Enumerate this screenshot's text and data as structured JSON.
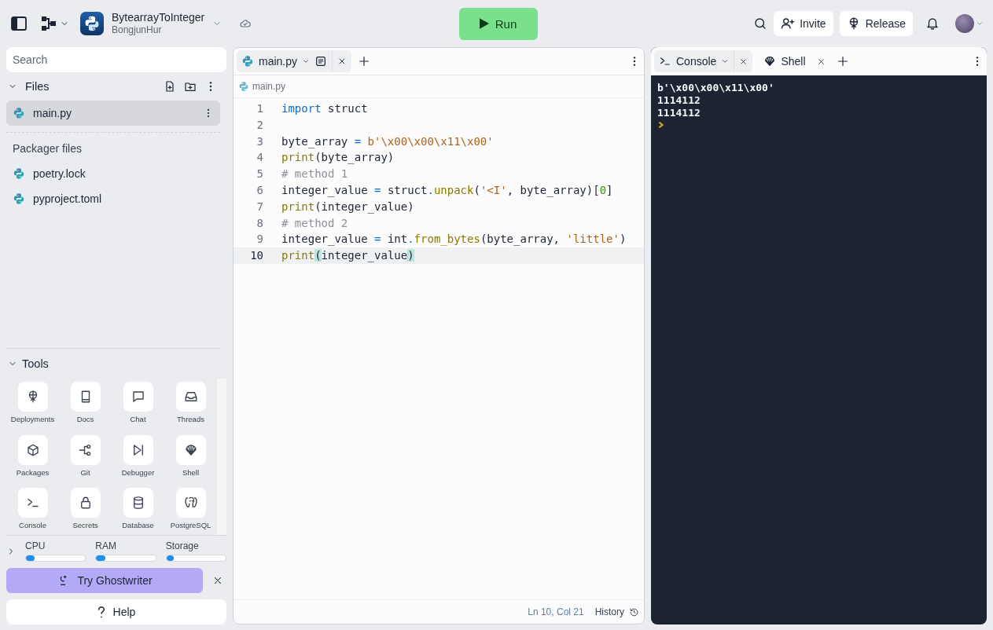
{
  "topbar": {
    "repl_name": "BytearrayToInteger",
    "owner": "BongjunHur",
    "run_label": "Run",
    "invite_label": "Invite",
    "release_label": "Release"
  },
  "sidebar": {
    "search": {
      "placeholder": "Search"
    },
    "files_title": "Files",
    "files": [
      {
        "name": "main.py",
        "selected": true
      }
    ],
    "packager_title": "Packager files",
    "packager_files": [
      {
        "name": "poetry.lock",
        "selected": false
      },
      {
        "name": "pyproject.toml",
        "selected": false
      }
    ],
    "tools_title": "Tools",
    "tools": [
      {
        "label": "Deployments",
        "kind": "deploy"
      },
      {
        "label": "Docs",
        "kind": "docs"
      },
      {
        "label": "Chat",
        "kind": "chat"
      },
      {
        "label": "Threads",
        "kind": "threads"
      },
      {
        "label": "Packages",
        "kind": "packages"
      },
      {
        "label": "Git",
        "kind": "git"
      },
      {
        "label": "Debugger",
        "kind": "debugger"
      },
      {
        "label": "Shell",
        "kind": "shell"
      },
      {
        "label": "Console",
        "kind": "console"
      },
      {
        "label": "Secrets",
        "kind": "secrets"
      },
      {
        "label": "Database",
        "kind": "database"
      },
      {
        "label": "PostgreSQL",
        "kind": "postgres"
      }
    ],
    "meters": [
      {
        "label": "CPU",
        "level": 0.15
      },
      {
        "label": "RAM",
        "level": 0.15
      },
      {
        "label": "Storage",
        "level": 0.13
      }
    ],
    "ghostwriter_label": "Try Ghostwriter",
    "help_label": "Help"
  },
  "editor": {
    "tab": {
      "label": "main.py",
      "selected": true
    },
    "breadcrumb": "main.py",
    "lines": [
      {
        "number": "1",
        "active": false,
        "tokens": [
          {
            "kind": "kw",
            "text": "import"
          },
          {
            "kind": "plain",
            "text": " struct"
          }
        ]
      },
      {
        "number": "2",
        "active": false
      },
      {
        "number": "3",
        "active": false,
        "tokens": [
          {
            "kind": "plain",
            "text": "byte_array "
          },
          {
            "kind": "op",
            "text": "= "
          },
          {
            "kind": "str",
            "text": "b'\\x00\\x00\\x11\\x00'"
          }
        ]
      },
      {
        "number": "4",
        "active": false,
        "tokens": [
          {
            "kind": "fn",
            "text": "print"
          },
          {
            "kind": "plain",
            "text": "(byte_array)"
          }
        ]
      },
      {
        "number": "5",
        "active": false,
        "tokens": [
          {
            "kind": "cm",
            "text": "# method 1"
          }
        ]
      },
      {
        "number": "6",
        "active": false,
        "tokens": [
          {
            "kind": "plain",
            "text": "integer_value "
          },
          {
            "kind": "op",
            "text": "="
          },
          {
            "kind": "plain",
            "text": " struct"
          },
          {
            "kind": "op",
            "text": "."
          },
          {
            "kind": "fn",
            "text": "unpack"
          },
          {
            "kind": "plain",
            "text": "("
          },
          {
            "kind": "str",
            "text": "'<I'"
          },
          {
            "kind": "plain",
            "text": ", byte_array)["
          },
          {
            "kind": "num",
            "text": "0"
          },
          {
            "kind": "plain",
            "text": "]"
          }
        ]
      },
      {
        "number": "7",
        "active": false,
        "tokens": [
          {
            "kind": "fn",
            "text": "print"
          },
          {
            "kind": "plain",
            "text": "(integer_value)"
          }
        ]
      },
      {
        "number": "8",
        "active": false,
        "tokens": [
          {
            "kind": "cm",
            "text": "# method 2"
          }
        ]
      },
      {
        "number": "9",
        "active": false,
        "tokens": [
          {
            "kind": "plain",
            "text": "integer_value "
          },
          {
            "kind": "op",
            "text": "="
          },
          {
            "kind": "plain",
            "text": " int"
          },
          {
            "kind": "op",
            "text": "."
          },
          {
            "kind": "fn",
            "text": "from_bytes"
          },
          {
            "kind": "plain",
            "text": "(byte_array, "
          },
          {
            "kind": "str",
            "text": "'little'"
          },
          {
            "kind": "plain",
            "text": ")"
          }
        ]
      },
      {
        "number": "10",
        "active": true,
        "tokens": [
          {
            "kind": "fn",
            "text": "print"
          },
          {
            "kind": "match",
            "text": "("
          },
          {
            "kind": "plain",
            "text": "integer_value"
          },
          {
            "kind": "match",
            "text": ")"
          }
        ]
      }
    ],
    "cursor_position": "Ln 10, Col 21",
    "history_label": "History"
  },
  "console": {
    "tabs": [
      {
        "label": "Console",
        "kind": "console",
        "selected": true
      },
      {
        "label": "Shell",
        "kind": "shell",
        "selected": false
      }
    ],
    "output": [
      "b'\\x00\\x00\\x11\\x00'",
      "1114112",
      "1114112"
    ]
  }
}
